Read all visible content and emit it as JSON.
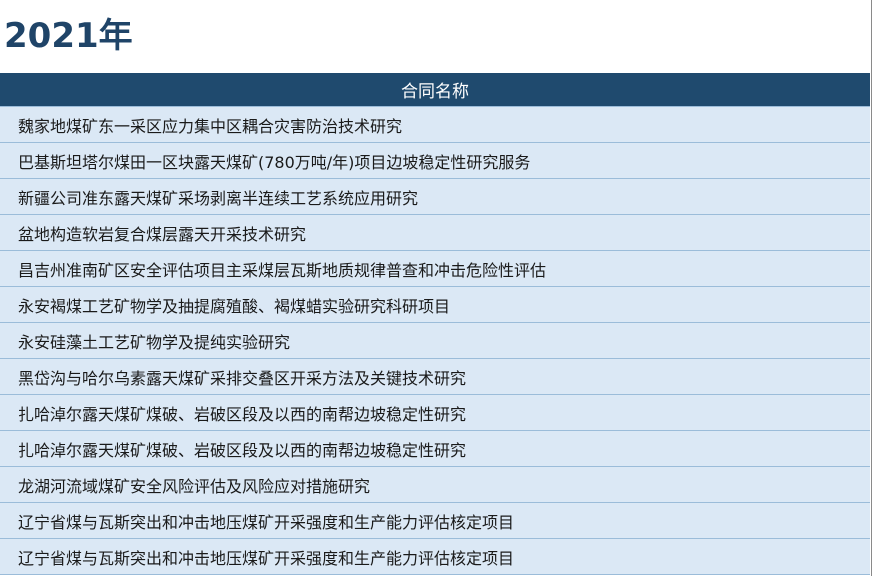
{
  "title": "2021年",
  "table": {
    "header": "合同名称",
    "rows": [
      "魏家地煤矿东一采区应力集中区耦合灾害防治技术研究",
      "巴基斯坦塔尔煤田一区块露天煤矿(780万吨/年)项目边坡稳定性研究服务",
      "新疆公司准东露天煤矿采场剥离半连续工艺系统应用研究",
      "盆地构造软岩复合煤层露天开采技术研究",
      "昌吉州准南矿区安全评估项目主采煤层瓦斯地质规律普查和冲击危险性评估",
      "永安褐煤工艺矿物学及抽提腐殖酸、褐煤蜡实验研究科研项目",
      "永安硅藻土工艺矿物学及提纯实验研究",
      "黑岱沟与哈尔乌素露天煤矿采排交叠区开采方法及关键技术研究",
      "扎哈淖尔露天煤矿煤破、岩破区段及以西的南帮边坡稳定性研究",
      "扎哈淖尔露天煤矿煤破、岩破区段及以西的南帮边坡稳定性研究",
      "龙湖河流域煤矿安全风险评估及风险应对措施研究",
      "辽宁省煤与瓦斯突出和冲击地压煤矿开采强度和生产能力评估核定项目",
      "辽宁省煤与瓦斯突出和冲击地压煤矿开采强度和生产能力评估核定项目"
    ]
  }
}
